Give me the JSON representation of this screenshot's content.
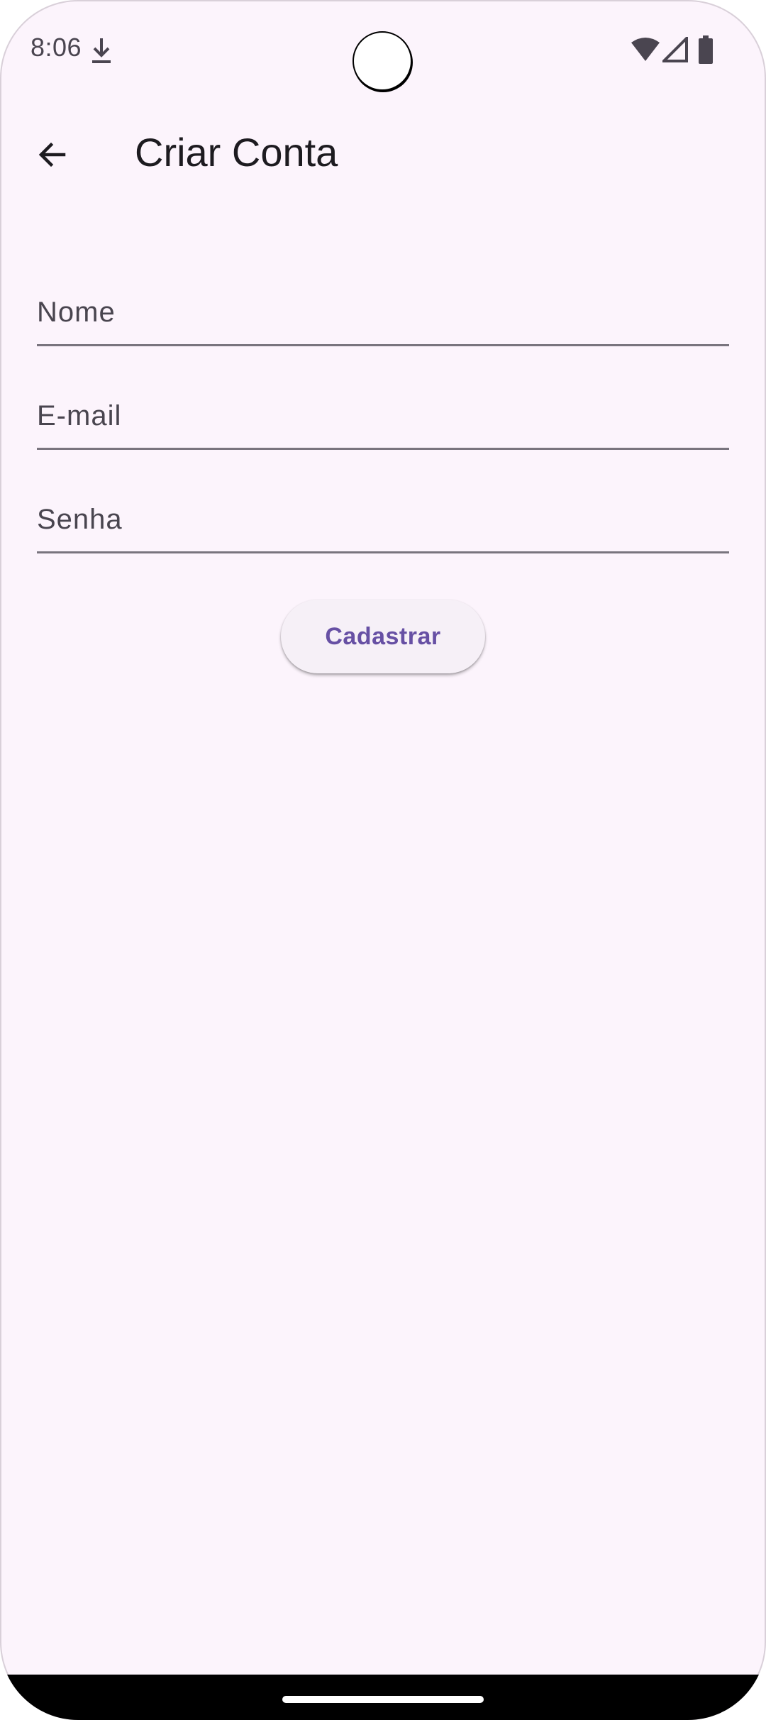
{
  "status_bar": {
    "time": "8:06",
    "icons": [
      "download-icon",
      "wifi-icon",
      "signal-icon",
      "battery-icon"
    ]
  },
  "app_bar": {
    "back_icon": "arrow-back-icon",
    "title": "Criar Conta"
  },
  "form": {
    "name_placeholder": "Nome",
    "name_value": "",
    "email_placeholder": "E-mail",
    "email_value": "",
    "password_placeholder": "Senha",
    "password_value": "",
    "submit_label": "Cadastrar"
  },
  "colors": {
    "background": "#fcf4fc",
    "accent": "#6750a4",
    "text": "#1d1b20",
    "field_line": "#79747e"
  }
}
